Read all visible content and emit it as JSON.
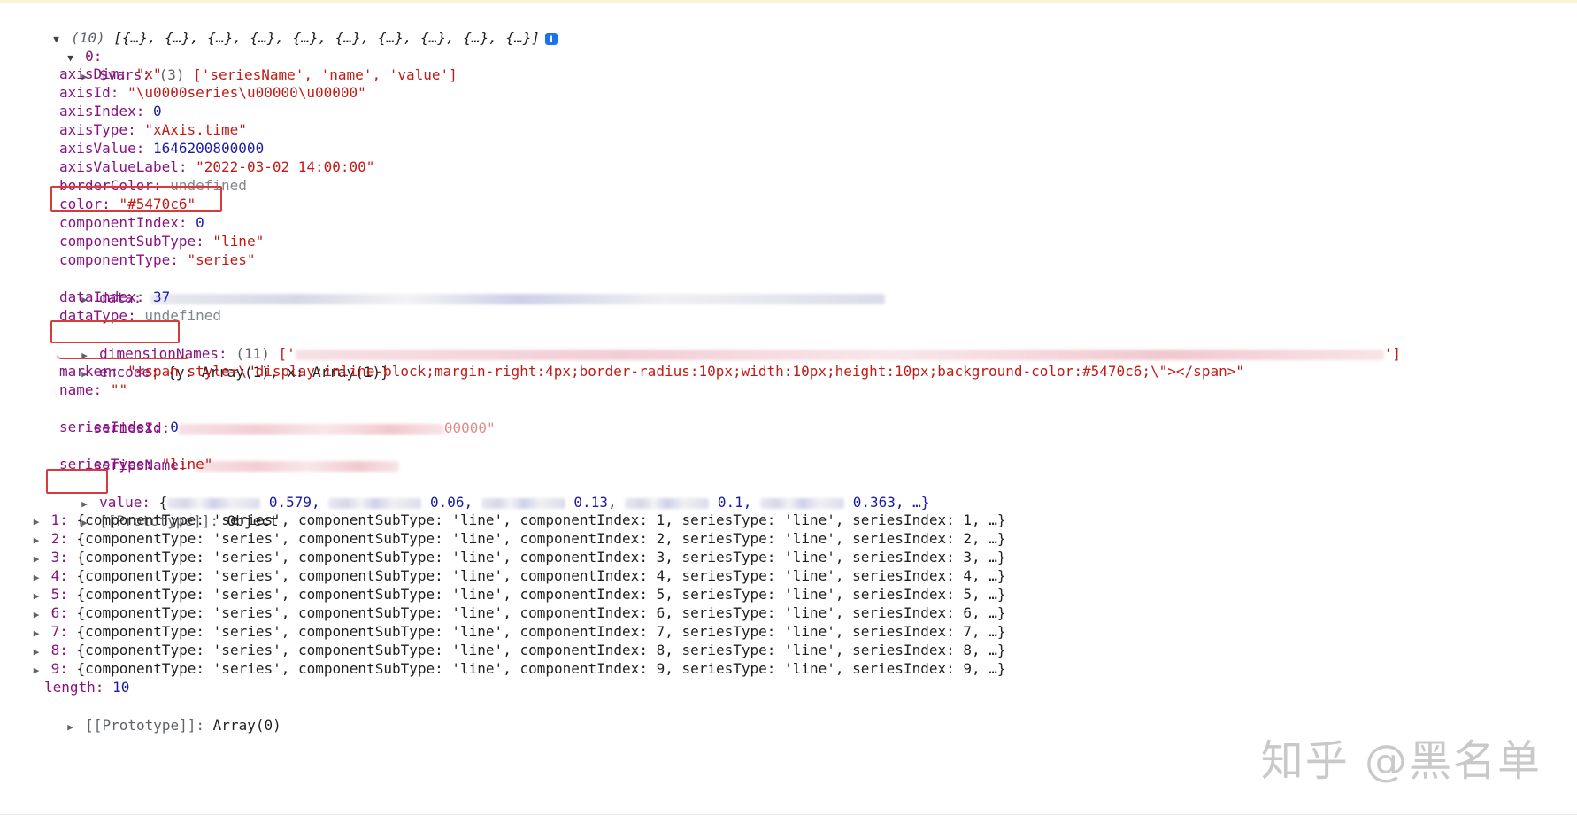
{
  "console": {
    "header": {
      "count": "(10)",
      "preview": "[{…}, {…}, {…}, {…}, {…}, {…}, {…}, {…}, {…}, {…}]",
      "info_icon": "i"
    },
    "item0": {
      "index_label": "0:",
      "vars": {
        "key": "$vars:",
        "count": "(3)",
        "value": "['seriesName', 'name', 'value']"
      },
      "axisDim": {
        "key": "axisDim:",
        "value": "\"x\""
      },
      "axisId": {
        "key": "axisId:",
        "value": "\"\\u0000series\\u00000\\u00000\""
      },
      "axisIndex": {
        "key": "axisIndex:",
        "value": "0"
      },
      "axisType": {
        "key": "axisType:",
        "value": "\"xAxis.time\""
      },
      "axisValue": {
        "key": "axisValue:",
        "value": "1646200800000"
      },
      "axisValueLabel": {
        "key": "axisValueLabel:",
        "value": "\"2022-03-02 14:00:00\""
      },
      "borderColor": {
        "key": "borderColor:",
        "value": "undefined"
      },
      "color": {
        "key": "color:",
        "value": "\"#5470c6\""
      },
      "componentIndex": {
        "key": "componentIndex:",
        "value": "0"
      },
      "componentSubType": {
        "key": "componentSubType:",
        "value": "\"line\""
      },
      "componentType": {
        "key": "componentType:",
        "value": "\"series\""
      },
      "data": {
        "key": "data:"
      },
      "dataIndex": {
        "key": "dataIndex:",
        "value": "37"
      },
      "dataType": {
        "key": "dataType:",
        "value": "undefined"
      },
      "dimensionNames": {
        "key": "dimensionNames:",
        "count": "(11)",
        "open": "['",
        "close": "']"
      },
      "encode": {
        "key": "encode:",
        "value": "{y: Array(1), x: Array(1)}"
      },
      "marker": {
        "key": "marker:",
        "value": "\"<span style=\\\"display:inline-block;margin-right:4px;border-radius:10px;width:10px;height:10px;background-color:#5470c6;\\\"></span>\""
      },
      "name": {
        "key": "name:",
        "value": "\"\""
      },
      "seriesId": {
        "key": "seriesId:",
        "tail": "00000\""
      },
      "seriesIndex": {
        "key": "seriesIndex:",
        "value": "0"
      },
      "seriesName": {
        "key": "seriesName:"
      },
      "seriesType": {
        "key": "seriesType:",
        "value": "\"line\""
      },
      "value": {
        "key": "value:",
        "open": "{",
        "v1": "0.579,",
        "v2": "0.06,",
        "v3": "0.13,",
        "v4": "0.1,",
        "v5": "0.363, …}"
      },
      "prototype": {
        "key": "[[Prototype]]:",
        "value": "Object"
      }
    },
    "items": [
      {
        "idx": "1:",
        "text": "{componentType: 'series', componentSubType: 'line', componentIndex: 1, seriesType: 'line', seriesIndex: 1, …}"
      },
      {
        "idx": "2:",
        "text": "{componentType: 'series', componentSubType: 'line', componentIndex: 2, seriesType: 'line', seriesIndex: 2, …}"
      },
      {
        "idx": "3:",
        "text": "{componentType: 'series', componentSubType: 'line', componentIndex: 3, seriesType: 'line', seriesIndex: 3, …}"
      },
      {
        "idx": "4:",
        "text": "{componentType: 'series', componentSubType: 'line', componentIndex: 4, seriesType: 'line', seriesIndex: 4, …}"
      },
      {
        "idx": "5:",
        "text": "{componentType: 'series', componentSubType: 'line', componentIndex: 5, seriesType: 'line', seriesIndex: 5, …}"
      },
      {
        "idx": "6:",
        "text": "{componentType: 'series', componentSubType: 'line', componentIndex: 6, seriesType: 'line', seriesIndex: 6, …}"
      },
      {
        "idx": "7:",
        "text": "{componentType: 'series', componentSubType: 'line', componentIndex: 7, seriesType: 'line', seriesIndex: 7, …}"
      },
      {
        "idx": "8:",
        "text": "{componentType: 'series', componentSubType: 'line', componentIndex: 8, seriesType: 'line', seriesIndex: 8, …}"
      },
      {
        "idx": "9:",
        "text": "{componentType: 'series', componentSubType: 'line', componentIndex: 9, seriesType: 'line', seriesIndex: 9, …}"
      }
    ],
    "length": {
      "key": "length:",
      "value": "10"
    },
    "array_prototype": {
      "key": "[[Prototype]]:",
      "value": "Array(0)"
    }
  },
  "watermark": "知乎 @黑名单",
  "colors": {
    "highlight": "#d83b3b",
    "key": "#881280",
    "string": "#c41a16",
    "number": "#1a1aa6"
  }
}
